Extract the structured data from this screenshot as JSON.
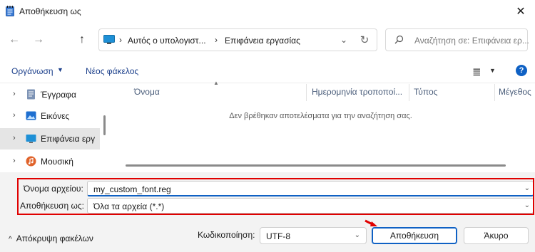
{
  "window": {
    "title": "Αποθήκευση ως",
    "close_glyph": "✕"
  },
  "nav": {
    "back_glyph": "←",
    "forward_glyph": "→",
    "up_glyph": "↑",
    "refresh_glyph": "↻",
    "breadcrumb": [
      "Αυτός ο υπολογιστ...",
      "Επιφάνεια εργασίας"
    ],
    "separator": "›",
    "search_placeholder": "Αναζήτηση σε: Επιφάνεια ερ..."
  },
  "toolbar": {
    "organize_label": "Οργάνωση",
    "new_folder_label": "Νέος φάκελος",
    "view_glyph": "≣",
    "help_glyph": "?"
  },
  "sidebar": {
    "items": [
      {
        "label": "Έγγραφα",
        "icon": "documents-icon",
        "color": "#5b7aa8"
      },
      {
        "label": "Εικόνες",
        "icon": "pictures-icon",
        "color": "#1e6fd0"
      },
      {
        "label": "Επιφάνεια εργ",
        "icon": "desktop-icon",
        "color": "#1e90d6"
      },
      {
        "label": "Μουσική",
        "icon": "music-icon",
        "color": "#e0632b"
      }
    ]
  },
  "filelist": {
    "columns": [
      "Όνομα",
      "Ημερομηνία τροποποί...",
      "Τύπος",
      "Μέγεθος"
    ],
    "empty_message": "Δεν βρέθηκαν αποτελέσματα για την αναζήτηση σας."
  },
  "form": {
    "filename_label": "Όνομα αρχείου:",
    "filename_value": "my_custom_font.reg",
    "savetype_label": "Αποθήκευση ως:",
    "savetype_value": "Όλα τα αρχεία  (*.*)",
    "encoding_label": "Κωδικοποίηση:",
    "encoding_value": "UTF-8"
  },
  "footer": {
    "hide_folders_label": "Απόκρυψη φακέλων",
    "save_label": "Αποθήκευση",
    "cancel_label": "Άκυρο"
  },
  "colors": {
    "accent": "#0f61c4",
    "annotation_red": "#e00000"
  }
}
